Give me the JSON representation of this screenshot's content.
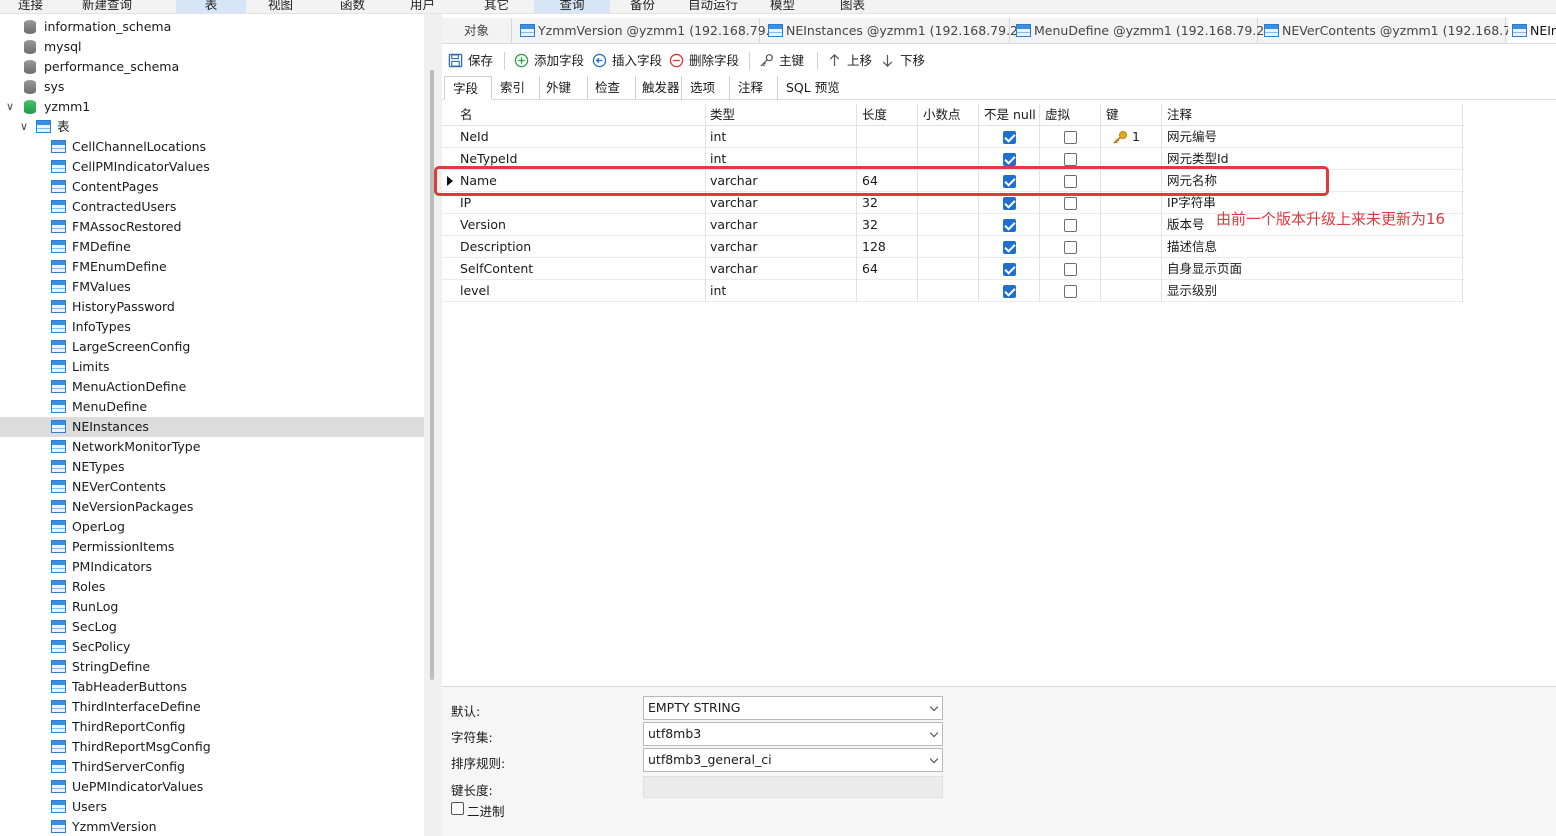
{
  "menu": [
    "连接",
    "新建查询",
    "表",
    "视图",
    "函数",
    "用户",
    "其它",
    "查询",
    "备份",
    "自动运行",
    "模型",
    "图表"
  ],
  "tree": {
    "databases": [
      "information_schema",
      "mysql",
      "performance_schema",
      "sys",
      "yzmm1"
    ],
    "folder": "表",
    "tables": [
      "CellChannelLocations",
      "CellPMIndicatorValues",
      "ContentPages",
      "ContractedUsers",
      "FMAssocRestored",
      "FMDefine",
      "FMEnumDefine",
      "FMValues",
      "HistoryPassword",
      "InfoTypes",
      "LargeScreenConfig",
      "Limits",
      "MenuActionDefine",
      "MenuDefine",
      "NEInstances",
      "NetworkMonitorType",
      "NETypes",
      "NEVerContents",
      "NeVersionPackages",
      "OperLog",
      "PermissionItems",
      "PMIndicators",
      "Roles",
      "RunLog",
      "SecLog",
      "SecPolicy",
      "StringDefine",
      "TabHeaderButtons",
      "ThirdInterfaceDefine",
      "ThirdReportConfig",
      "ThirdReportMsgConfig",
      "ThirdServerConfig",
      "UePMIndicatorValues",
      "Users",
      "YzmmVersion"
    ],
    "selected": "NEInstances"
  },
  "editor_tabs": [
    "对象",
    "YzmmVersion @yzmm1 (192.168.79....",
    "NEInstances @yzmm1 (192.168.79.2...",
    "MenuDefine @yzmm1 (192.168.79.2...",
    "NEVerContents @yzmm1 (192.168.7...",
    "NEIn"
  ],
  "toolbar": {
    "save": "保存",
    "add_field": "添加字段",
    "insert_field": "插入字段",
    "delete_field": "删除字段",
    "primary_key": "主键",
    "move_up": "上移",
    "move_down": "下移"
  },
  "sub_tabs": [
    "字段",
    "索引",
    "外键",
    "检查",
    "触发器",
    "选项",
    "注释",
    "SQL 预览"
  ],
  "grid": {
    "headers": {
      "name": "名",
      "type": "类型",
      "length": "长度",
      "decimals": "小数点",
      "not_null": "不是 null",
      "virtual": "虚拟",
      "key": "键",
      "comment": "注释"
    },
    "rows": [
      {
        "name": "NeId",
        "type": "int",
        "length": "",
        "not_null": true,
        "virtual": false,
        "key": "1",
        "comment": "网元编号"
      },
      {
        "name": "NeTypeId",
        "type": "int",
        "length": "",
        "not_null": true,
        "virtual": false,
        "key": "",
        "comment": "网元类型Id"
      },
      {
        "name": "Name",
        "type": "varchar",
        "length": "64",
        "not_null": true,
        "virtual": false,
        "key": "",
        "comment": "网元名称"
      },
      {
        "name": "IP",
        "type": "varchar",
        "length": "32",
        "not_null": true,
        "virtual": false,
        "key": "",
        "comment": "IP字符串"
      },
      {
        "name": "Version",
        "type": "varchar",
        "length": "32",
        "not_null": true,
        "virtual": false,
        "key": "",
        "comment": "版本号"
      },
      {
        "name": "Description",
        "type": "varchar",
        "length": "128",
        "not_null": true,
        "virtual": false,
        "key": "",
        "comment": "描述信息"
      },
      {
        "name": "SelfContent",
        "type": "varchar",
        "length": "64",
        "not_null": true,
        "virtual": false,
        "key": "",
        "comment": "自身显示页面"
      },
      {
        "name": "level",
        "type": "int",
        "length": "",
        "not_null": true,
        "virtual": false,
        "key": "",
        "comment": "显示级别"
      }
    ],
    "current_row": 2
  },
  "annotation": "由前一个版本升级上来未更新为16",
  "properties": {
    "default_label": "默认:",
    "default_value": "EMPTY STRING",
    "charset_label": "字符集:",
    "charset_value": "utf8mb3",
    "collation_label": "排序规则:",
    "collation_value": "utf8mb3_general_ci",
    "key_length_label": "键长度:",
    "binary_label": "二进制"
  },
  "colors": {
    "accent": "#1f6fd1",
    "highlight": "#e0393e",
    "selected_row": "#dcdcdc"
  }
}
